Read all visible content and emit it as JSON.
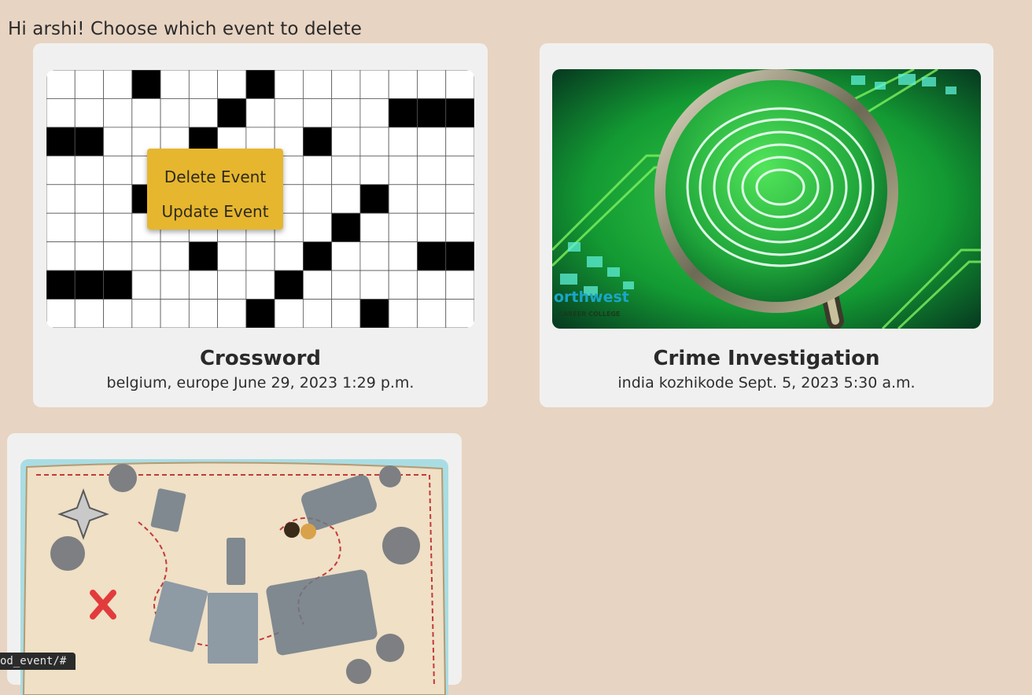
{
  "greeting": "Hi arshi! Choose which event to delete",
  "context_menu": {
    "delete_label": "Delete Event",
    "update_label": "Update Event"
  },
  "events": [
    {
      "title": "Crossword",
      "meta": "belgium, europe June 29, 2023 1:29 p.m.",
      "image": "crossword-puzzle-image"
    },
    {
      "title": "Crime Investigation",
      "meta": "india kozhikode Sept. 5, 2023 5:30 a.m.",
      "image": "fingerprint-magnifier-image",
      "image_watermark": "orthwest",
      "image_watermark_sub": "CAREER COLLEGE"
    },
    {
      "title": "",
      "meta": "",
      "image": "treasure-map-image"
    }
  ],
  "status_url": "od_event/#"
}
